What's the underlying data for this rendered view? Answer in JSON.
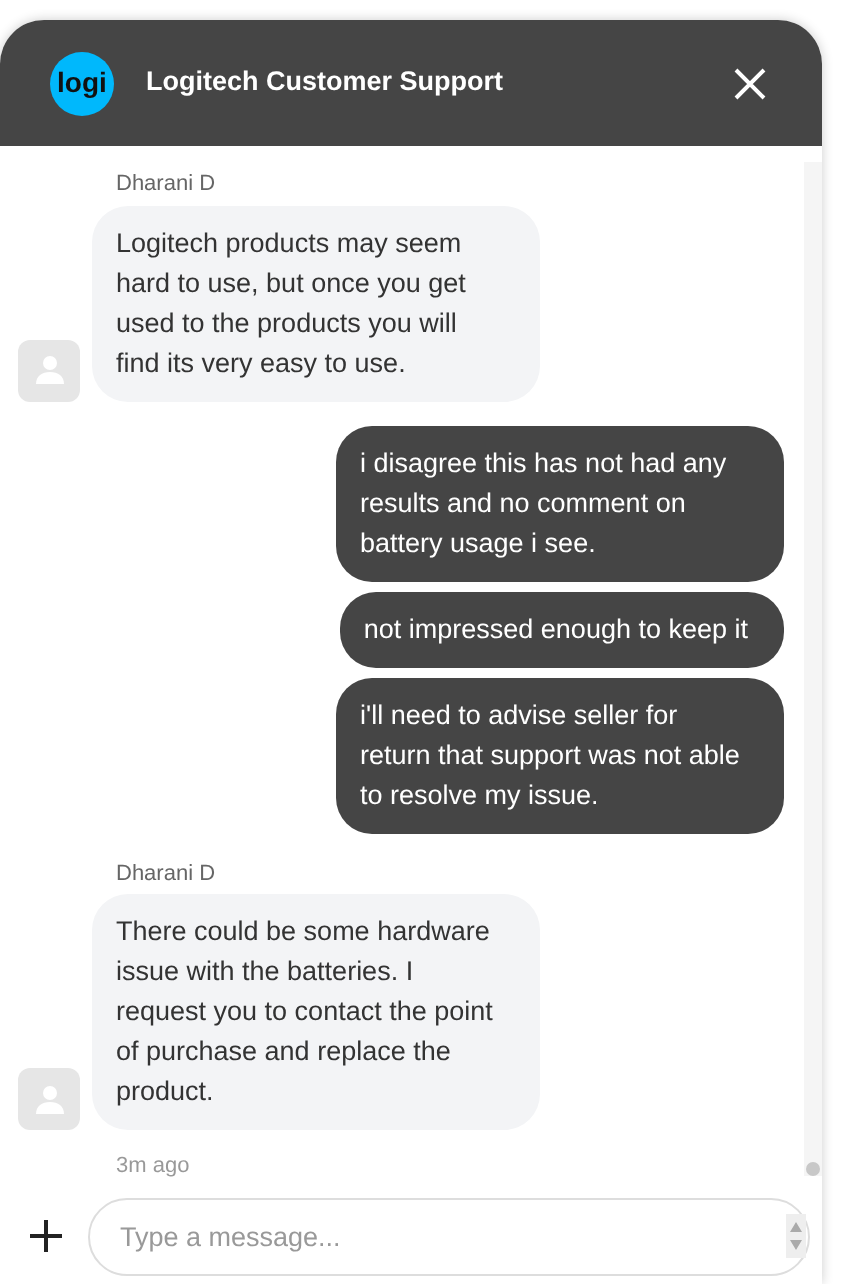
{
  "header": {
    "logo": "logi",
    "title": "Logitech Customer Support"
  },
  "messages": [
    {
      "kind": "agent",
      "sender": "Dharani D",
      "texts": [
        "Logitech products may seem hard to use, but once you get used to the products you will find its very easy to use."
      ]
    },
    {
      "kind": "user",
      "texts": [
        "i disagree this has not had any results and no comment on battery usage i see.",
        "not impressed enough to keep it",
        "i'll need to advise seller for return that support was not able to resolve my issue."
      ]
    },
    {
      "kind": "agent",
      "sender": "Dharani D",
      "texts": [
        "There could be some hardware issue with the batteries. I request you to contact the point of purchase and replace the product."
      ],
      "time": "3m ago"
    }
  ],
  "composer": {
    "placeholder": "Type a message..."
  }
}
